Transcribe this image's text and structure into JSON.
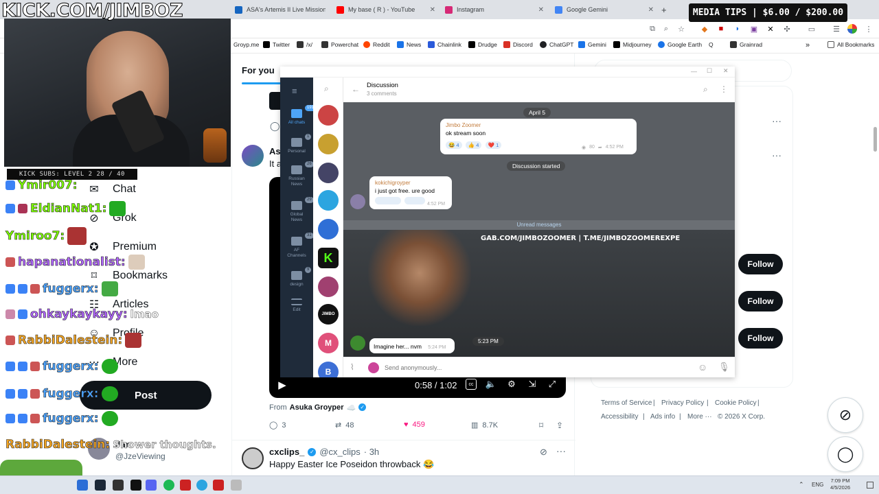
{
  "browser": {
    "tabs": [
      {
        "title": "ASA's Artemis II Live Mission",
        "color": "#1565c0"
      },
      {
        "title": "My base ( R ) - YouTube",
        "color": "#ff0000"
      },
      {
        "title": "Instagram",
        "color": "#d62976"
      },
      {
        "title": "Google Gemini",
        "color": "#4285f4"
      }
    ],
    "new_tab": "+",
    "bookmarks": [
      {
        "label": "Groyp.me",
        "color": "#888888"
      },
      {
        "label": "Twitter",
        "color": "#000000"
      },
      {
        "label": "/x/",
        "color": "#333333"
      },
      {
        "label": "Powerchat",
        "color": "#333333"
      },
      {
        "label": "Reddit",
        "color": "#ff4500"
      },
      {
        "label": "News",
        "color": "#1a73e8"
      },
      {
        "label": "Chainlink",
        "color": "#2a5ada"
      },
      {
        "label": "Drudge",
        "color": "#000000"
      },
      {
        "label": "Discord",
        "color": "#d93025"
      },
      {
        "label": "ChatGPT",
        "color": "#202124"
      },
      {
        "label": "Gemini",
        "color": "#1a73e8"
      },
      {
        "label": "Midjourney",
        "color": "#000000"
      },
      {
        "label": "Google Earth",
        "color": "#1a73e8"
      },
      {
        "label": "Q",
        "color": "#000000"
      },
      {
        "label": "Grainrad",
        "color": "#333333"
      }
    ],
    "bookmarks_overflow": "»",
    "all_bookmarks": "All Bookmarks"
  },
  "overlay": {
    "media_tips": "MEDIA TIPS | $6.00 / $200.00",
    "kick_title": "KICK.COM/JIMBOZ",
    "kick_subs": "KICK SUBS: LEVEL 2 28 / 40",
    "chat": [
      {
        "user": "Ymir007:",
        "color": "#7cfc00",
        "msg": ""
      },
      {
        "user": "EldianNat1:",
        "color": "#7cfc00",
        "msg": ""
      },
      {
        "user": "Ymiroo7:",
        "color": "#7cfc00",
        "msg": ""
      },
      {
        "user": "hapanationalist:",
        "color": "#b266ff",
        "msg": ""
      },
      {
        "user": "fuggerx:",
        "color": "#4aa3ff",
        "msg": ""
      },
      {
        "user": "ohkaykaykayy:",
        "color": "#b266ff",
        "msg": "lmao"
      },
      {
        "user": "RabbiDalestein:",
        "color": "#f5a623",
        "msg": ""
      },
      {
        "user": "fuggerx:",
        "color": "#4aa3ff",
        "msg": ""
      },
      {
        "user": "fuggerx:",
        "color": "#4aa3ff",
        "msg": ""
      },
      {
        "user": "fuggerx:",
        "color": "#4aa3ff",
        "msg": ""
      },
      {
        "user": "RabbiDalestein:",
        "color": "#f5a623",
        "msg": "Shower thoughts."
      }
    ]
  },
  "x": {
    "nav": {
      "chat": "Chat",
      "grok": "Grok",
      "premium": "Premium",
      "bookmarks": "Bookmarks",
      "articles": "Articles",
      "profile": "Profile",
      "more": "More",
      "post": "Post"
    },
    "account": {
      "name": "Jim",
      "handle": "@JzeViewing"
    },
    "feed": {
      "for_you": "For you",
      "partial_name": "As",
      "partial_text": "It a",
      "video": {
        "time": "0:58 / 1:02"
      },
      "from_label": "From",
      "from_name": "Asuka Groyper",
      "from_emoji": "☁️",
      "stats": {
        "replies": "3",
        "reposts": "48",
        "likes": "459",
        "views": "8.7K"
      },
      "next_post": {
        "name": "cxclips_",
        "handle": "@cx_clips",
        "time": "· 3h",
        "text": "Happy Easter Ice Poseidon throwback 😂"
      }
    },
    "right": {
      "follow_label": "Follow",
      "footer": [
        "Terms of Service",
        "|",
        "Privacy Policy",
        "|",
        "Cookie Policy",
        "|",
        "Accessibility",
        "|",
        "Ads info",
        "|",
        "More ···",
        "© 2026 X Corp."
      ]
    }
  },
  "telegram": {
    "folders": [
      {
        "label": "All chats",
        "count": "191"
      },
      {
        "label": "Personal",
        "count": "1"
      },
      {
        "label": "Russian News",
        "count": "26"
      },
      {
        "label": "Global News",
        "count": "29"
      },
      {
        "label": "AF Channels",
        "count": "31"
      },
      {
        "label": "design",
        "count": "9"
      },
      {
        "label": "Edit",
        "count": ""
      }
    ],
    "avatars": [
      {
        "label": "",
        "color": "#c44"
      },
      {
        "label": "",
        "color": "#c8a030"
      },
      {
        "label": "",
        "color": "#446"
      },
      {
        "label": "",
        "color": "#2ca5e0"
      },
      {
        "label": "",
        "color": "#2f6fd6"
      },
      {
        "label": "K",
        "color": "#53fc18"
      },
      {
        "label": "",
        "color": "#a04070"
      },
      {
        "label": "JIMBO",
        "color": "#111111"
      },
      {
        "label": "M",
        "color": "#e0507a"
      },
      {
        "label": "B",
        "color": "#3d6fd6"
      }
    ],
    "header": {
      "title": "Discussion",
      "subtitle": "3 comments"
    },
    "date_pill": "April 5",
    "post": {
      "author": "Jimbo Zoomer",
      "text": "ok stream soon",
      "reactions": [
        {
          "emoji": "😂",
          "count": "4"
        },
        {
          "emoji": "👍",
          "count": "4"
        },
        {
          "emoji": "❤️",
          "count": "1"
        }
      ],
      "views": "80",
      "time": "4:52 PM"
    },
    "discussion_started": "Discussion started",
    "comment1": {
      "author": "kokichigroyper",
      "text": "i just got free. ure good",
      "time": "4:52 PM"
    },
    "unread": "Unread messages",
    "banner": "GAB.COM/JIMBOZOOMER | T.ME/JIMBOZOOMEREXPE",
    "media_time": "5:23 PM",
    "comment2": {
      "text": "Imagine her... nvm",
      "time": "5:24 PM"
    },
    "input_placeholder": "Send anonymously..."
  },
  "taskbar": {
    "lang": "ENG",
    "time": "7:09 PM",
    "date": "4/5/2026"
  }
}
